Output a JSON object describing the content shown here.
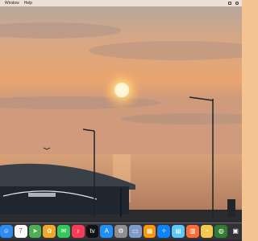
{
  "menubar": {
    "items": [
      "Window",
      "Help"
    ]
  },
  "dock": {
    "apps": [
      {
        "name": "finder",
        "glyph": "☺",
        "color": "#2d8cf0"
      },
      {
        "name": "calendar",
        "glyph": "7",
        "color": "#ffffff"
      },
      {
        "name": "maps",
        "glyph": "➤",
        "color": "#4caf50"
      },
      {
        "name": "photos",
        "glyph": "✿",
        "color": "#f5a623"
      },
      {
        "name": "messages",
        "glyph": "✉",
        "color": "#34c759"
      },
      {
        "name": "music",
        "glyph": "♪",
        "color": "#fa3c5a"
      },
      {
        "name": "apple-tv",
        "glyph": "tv",
        "color": "#111111"
      },
      {
        "name": "app-store",
        "glyph": "A",
        "color": "#1e90ff"
      },
      {
        "name": "system-settings",
        "glyph": "⚙",
        "color": "#8e8e93"
      },
      {
        "name": "preview",
        "glyph": "▭",
        "color": "#7f9cc8"
      },
      {
        "name": "launchpad",
        "glyph": "▦",
        "color": "#ff9500"
      },
      {
        "name": "safari",
        "glyph": "✧",
        "color": "#0a84ff"
      },
      {
        "name": "keynote",
        "glyph": "▤",
        "color": "#5ac8fa"
      },
      {
        "name": "books",
        "glyph": "▥",
        "color": "#ff6b35"
      },
      {
        "name": "clock",
        "glyph": "◔",
        "color": "#f2c94c"
      },
      {
        "name": "globe-app",
        "glyph": "◍",
        "color": "#2e7d32"
      },
      {
        "name": "screen-capture",
        "glyph": "▣",
        "color": "#333333"
      }
    ]
  }
}
